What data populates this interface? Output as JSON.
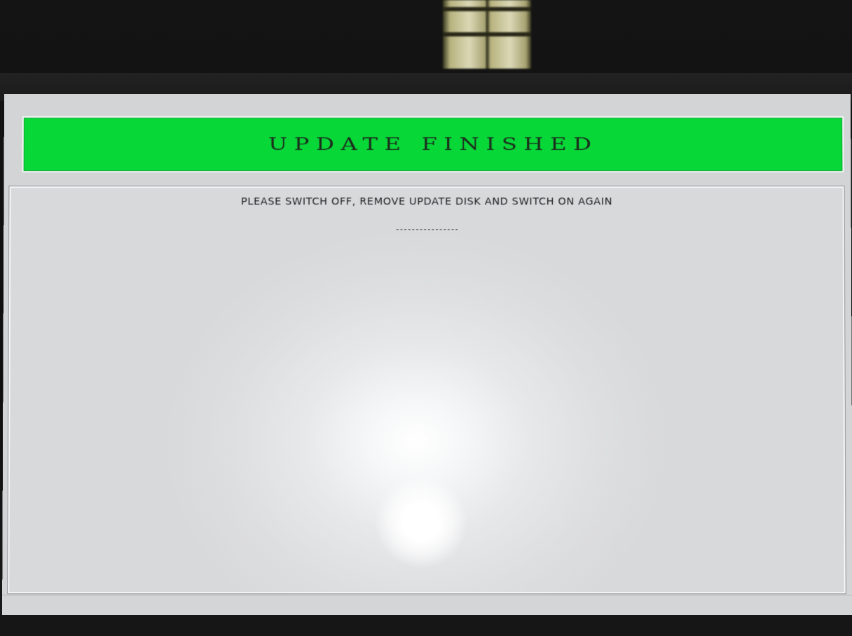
{
  "screen": {
    "header": {
      "title": "UPDATE  FINISHED",
      "background_color": "#07d838"
    },
    "content": {
      "message": "PLEASE SWITCH OFF, REMOVE UPDATE DISK AND SWITCH ON AGAIN",
      "separator": "----------------"
    }
  }
}
